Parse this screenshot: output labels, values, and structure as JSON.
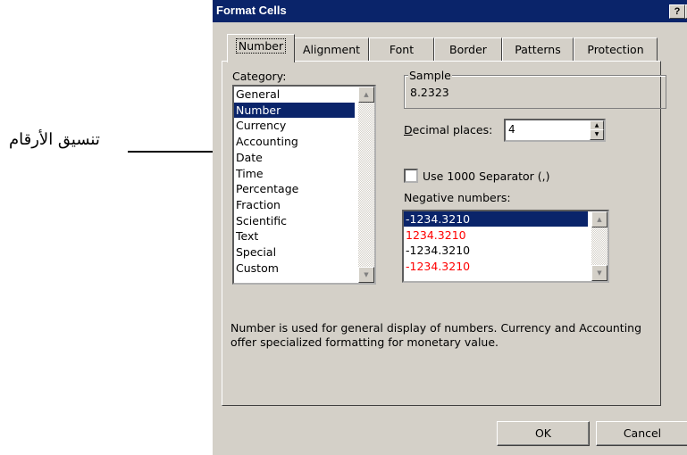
{
  "annotation": {
    "text": "تنسيق الأرقام"
  },
  "dialog": {
    "title": "Format Cells",
    "help_button": "?",
    "close_button": "✕",
    "tabs": [
      {
        "label": "Number",
        "active": true
      },
      {
        "label": "Alignment"
      },
      {
        "label": "Font"
      },
      {
        "label": "Border"
      },
      {
        "label": "Patterns"
      },
      {
        "label": "Protection"
      }
    ],
    "category": {
      "label": "Category:",
      "items": [
        "General",
        "Number",
        "Currency",
        "Accounting",
        "Date",
        "Time",
        "Percentage",
        "Fraction",
        "Scientific",
        "Text",
        "Special",
        "Custom"
      ],
      "selected": "Number"
    },
    "sample": {
      "label": "Sample",
      "value": "8.2323"
    },
    "decimal_places": {
      "label": "Decimal places:",
      "value": "4"
    },
    "separator": {
      "label": "Use 1000 Separator (,)",
      "checked": false
    },
    "negative_numbers": {
      "label": "Negative numbers:",
      "items": [
        {
          "text": "-1234.3210",
          "color": "#000000",
          "selected": true
        },
        {
          "text": "1234.3210",
          "color": "#ff0000"
        },
        {
          "text": "-1234.3210",
          "color": "#000000"
        },
        {
          "text": "-1234.3210",
          "color": "#ff0000"
        }
      ]
    },
    "description": "Number is used for general display of numbers.  Currency and Accounting offer specialized formatting for monetary value.",
    "ok_label": "OK",
    "cancel_label": "Cancel",
    "colors": {
      "title_bar": "#0a246a",
      "face": "#d4d0c8",
      "selection": "#0a246a",
      "negative_red": "#ff0000"
    }
  }
}
